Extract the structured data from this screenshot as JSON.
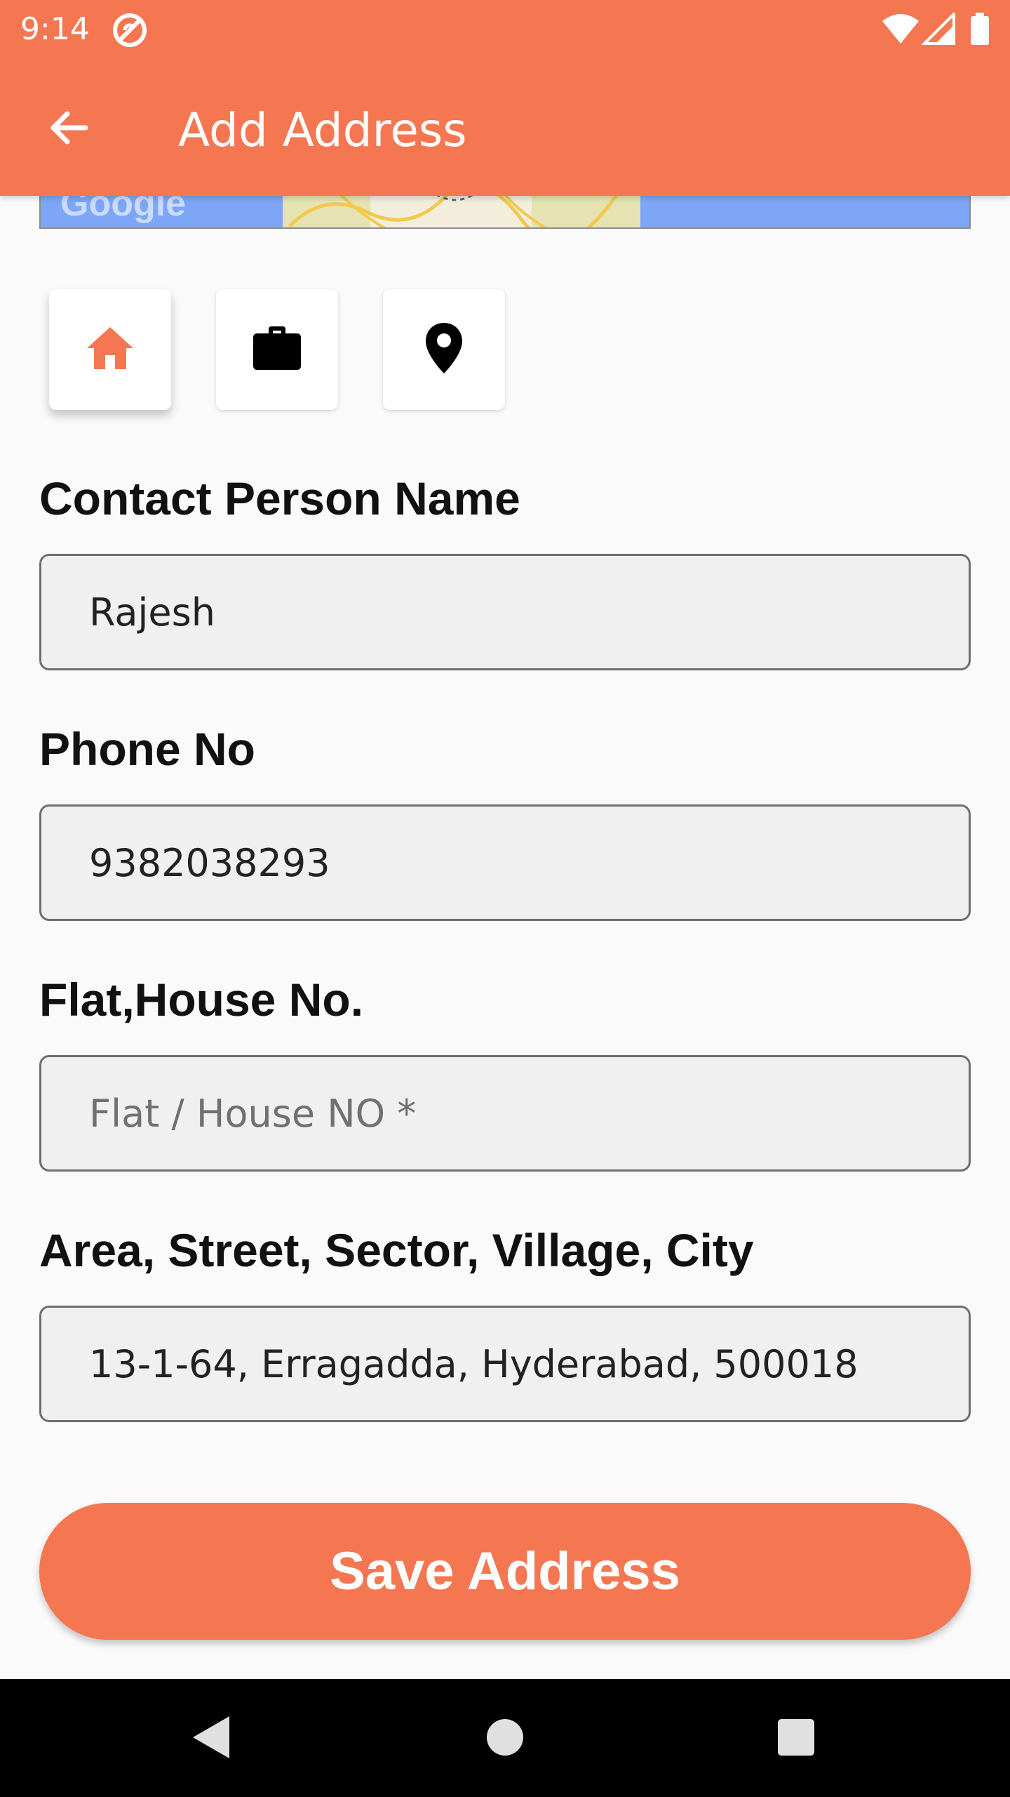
{
  "status_bar": {
    "time": "9:14",
    "icons": [
      "sync-icon",
      "wifi-icon",
      "signal-icon",
      "battery-icon"
    ]
  },
  "app_bar": {
    "title": "Add Address",
    "back_icon": "arrow-back-icon",
    "color": "#F47752"
  },
  "map": {
    "logo_text": "Google"
  },
  "address_types": [
    {
      "icon": "home-icon",
      "selected": true,
      "color": "#F47752"
    },
    {
      "icon": "briefcase-icon",
      "selected": false,
      "color": "#000000"
    },
    {
      "icon": "location-pin-icon",
      "selected": false,
      "color": "#000000"
    }
  ],
  "form": {
    "contact_name": {
      "label": "Contact Person Name",
      "value": "Rajesh",
      "placeholder": ""
    },
    "phone": {
      "label": "Phone No",
      "value": "9382038293",
      "placeholder": ""
    },
    "flat": {
      "label": "Flat,House No.",
      "value": "",
      "placeholder": "Flat / House NO *"
    },
    "area": {
      "label": "Area, Street, Sector, Village, City",
      "value": "13-1-64, Erragadda, Hyderabad, 500018",
      "placeholder": ""
    }
  },
  "save_button": {
    "label": "Save Address"
  },
  "nav_bar": {
    "icons": [
      "nav-back-icon",
      "nav-home-icon",
      "nav-recents-icon"
    ]
  }
}
